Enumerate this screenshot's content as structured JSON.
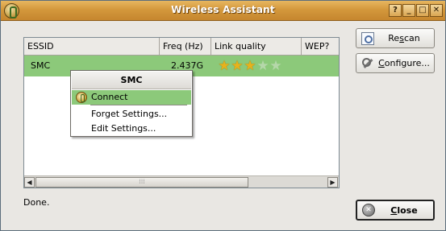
{
  "window": {
    "title": "Wireless Assistant",
    "controls": {
      "help": "?",
      "minimize": "_",
      "maximize": "□",
      "close": "✕"
    }
  },
  "list": {
    "columns": [
      "ESSID",
      "Freq (Hz)",
      "Link quality",
      "WEP?"
    ],
    "rows": [
      {
        "essid": "SMC",
        "freq": "2.437G",
        "quality_stars": 3,
        "quality_max": 5,
        "wep": ""
      }
    ]
  },
  "context_menu": {
    "title": "SMC",
    "items": [
      "Connect",
      "Forget Settings...",
      "Edit Settings..."
    ]
  },
  "status": "Done.",
  "buttons": {
    "rescan": {
      "pre": "Re",
      "u": "s",
      "post": "can"
    },
    "configure": {
      "pre": "",
      "u": "C",
      "post": "onfigure..."
    },
    "close": {
      "pre": "",
      "u": "C",
      "post": "lose"
    }
  },
  "colors": {
    "titlebar": "#d4983c",
    "selection": "#8cc97a",
    "star": "#e7b21c"
  }
}
